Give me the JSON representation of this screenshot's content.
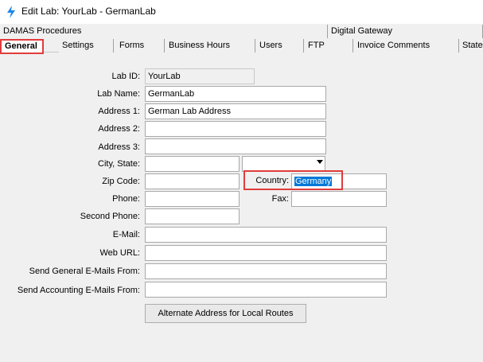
{
  "window": {
    "title": "Edit Lab: YourLab - GermanLab"
  },
  "tabs_back": [
    "DAMAS Procedures",
    "Digital Gateway"
  ],
  "tabs_front": [
    "General",
    "Settings",
    "Forms",
    "Business Hours",
    "Users",
    "FTP",
    "Invoice Comments",
    "State"
  ],
  "form": {
    "lab_id": {
      "label": "Lab ID:",
      "value": "YourLab"
    },
    "lab_name": {
      "label": "Lab Name:",
      "value": "GermanLab"
    },
    "address1": {
      "label": "Address 1:",
      "value": "German Lab Address"
    },
    "address2": {
      "label": "Address 2:",
      "value": ""
    },
    "address3": {
      "label": "Address 3:",
      "value": ""
    },
    "city_state": {
      "label": "City, State:",
      "city": "",
      "state": ""
    },
    "zip": {
      "label": "Zip Code:",
      "value": ""
    },
    "country": {
      "label": "Country:",
      "value": "Germany"
    },
    "phone": {
      "label": "Phone:",
      "value": ""
    },
    "fax": {
      "label": "Fax:",
      "value": ""
    },
    "second_phone": {
      "label": "Second Phone:",
      "value": ""
    },
    "email": {
      "label": "E-Mail:",
      "value": ""
    },
    "web_url": {
      "label": "Web URL:",
      "value": ""
    },
    "general_from": {
      "label": "Send General E-Mails From:",
      "value": ""
    },
    "accounting_from": {
      "label": "Send Accounting E-Mails From:",
      "value": ""
    }
  },
  "buttons": {
    "alternate_address": "Alternate Address for Local Routes"
  },
  "colors": {
    "highlight_box": "#e03c3c",
    "selection": "#0078d7"
  }
}
